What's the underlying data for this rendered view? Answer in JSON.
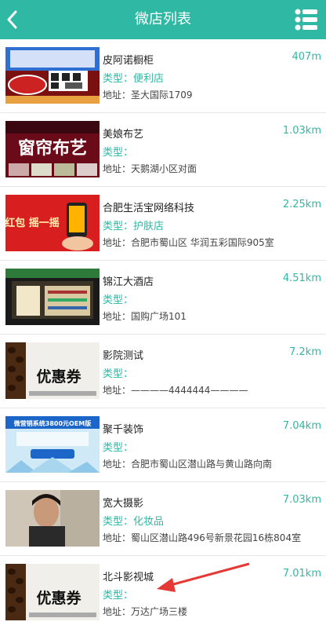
{
  "header": {
    "title": "微店列表",
    "back_icon": "chevron-left-icon",
    "menu_icon": "list-menu-icon"
  },
  "shops": [
    {
      "name": "皮阿诺橱柜",
      "distance": "407m",
      "type_label": "类型：",
      "type_value": "便利店",
      "address": "地址：圣大国际1709"
    },
    {
      "name": "美娘布艺",
      "distance": "1.03km",
      "type_label": "类型：",
      "type_value": "",
      "address": "地址：天鹅湖小区对面",
      "thumb_text": "窗帘布艺"
    },
    {
      "name": "合肥生活宝网络科技",
      "distance": "2.25km",
      "type_label": "类型：",
      "type_value": "护肤店",
      "address": "地址：合肥市蜀山区 华润五彩国际905室",
      "thumb_text": "红包 摇一摇"
    },
    {
      "name": "锦江大酒店",
      "distance": "4.51km",
      "type_label": "类型：",
      "type_value": "",
      "address": "地址：国购广场101"
    },
    {
      "name": "影院测试",
      "distance": "7.2km",
      "type_label": "类型：",
      "type_value": "",
      "address": "地址：————4444444————",
      "thumb_text": "优惠券"
    },
    {
      "name": "聚千装饰",
      "distance": "7.04km",
      "type_label": "类型：",
      "type_value": "",
      "address": "地址：合肥市蜀山区潜山路与黄山路向南",
      "thumb_text": "微营销系统3800元OEM版"
    },
    {
      "name": "宽大摄影",
      "distance": "7.03km",
      "type_label": "类型：",
      "type_value": "化妆品",
      "address": "地址：蜀山区潜山路496号新景花园16栋804室"
    },
    {
      "name": "北斗影视城",
      "distance": "7.01km",
      "type_label": "类型：",
      "type_value": "",
      "address": "地址：万达广场三楼",
      "thumb_text": "优惠券"
    }
  ],
  "colors": {
    "accent": "#2fb8a4",
    "arrow": "#e53935"
  }
}
